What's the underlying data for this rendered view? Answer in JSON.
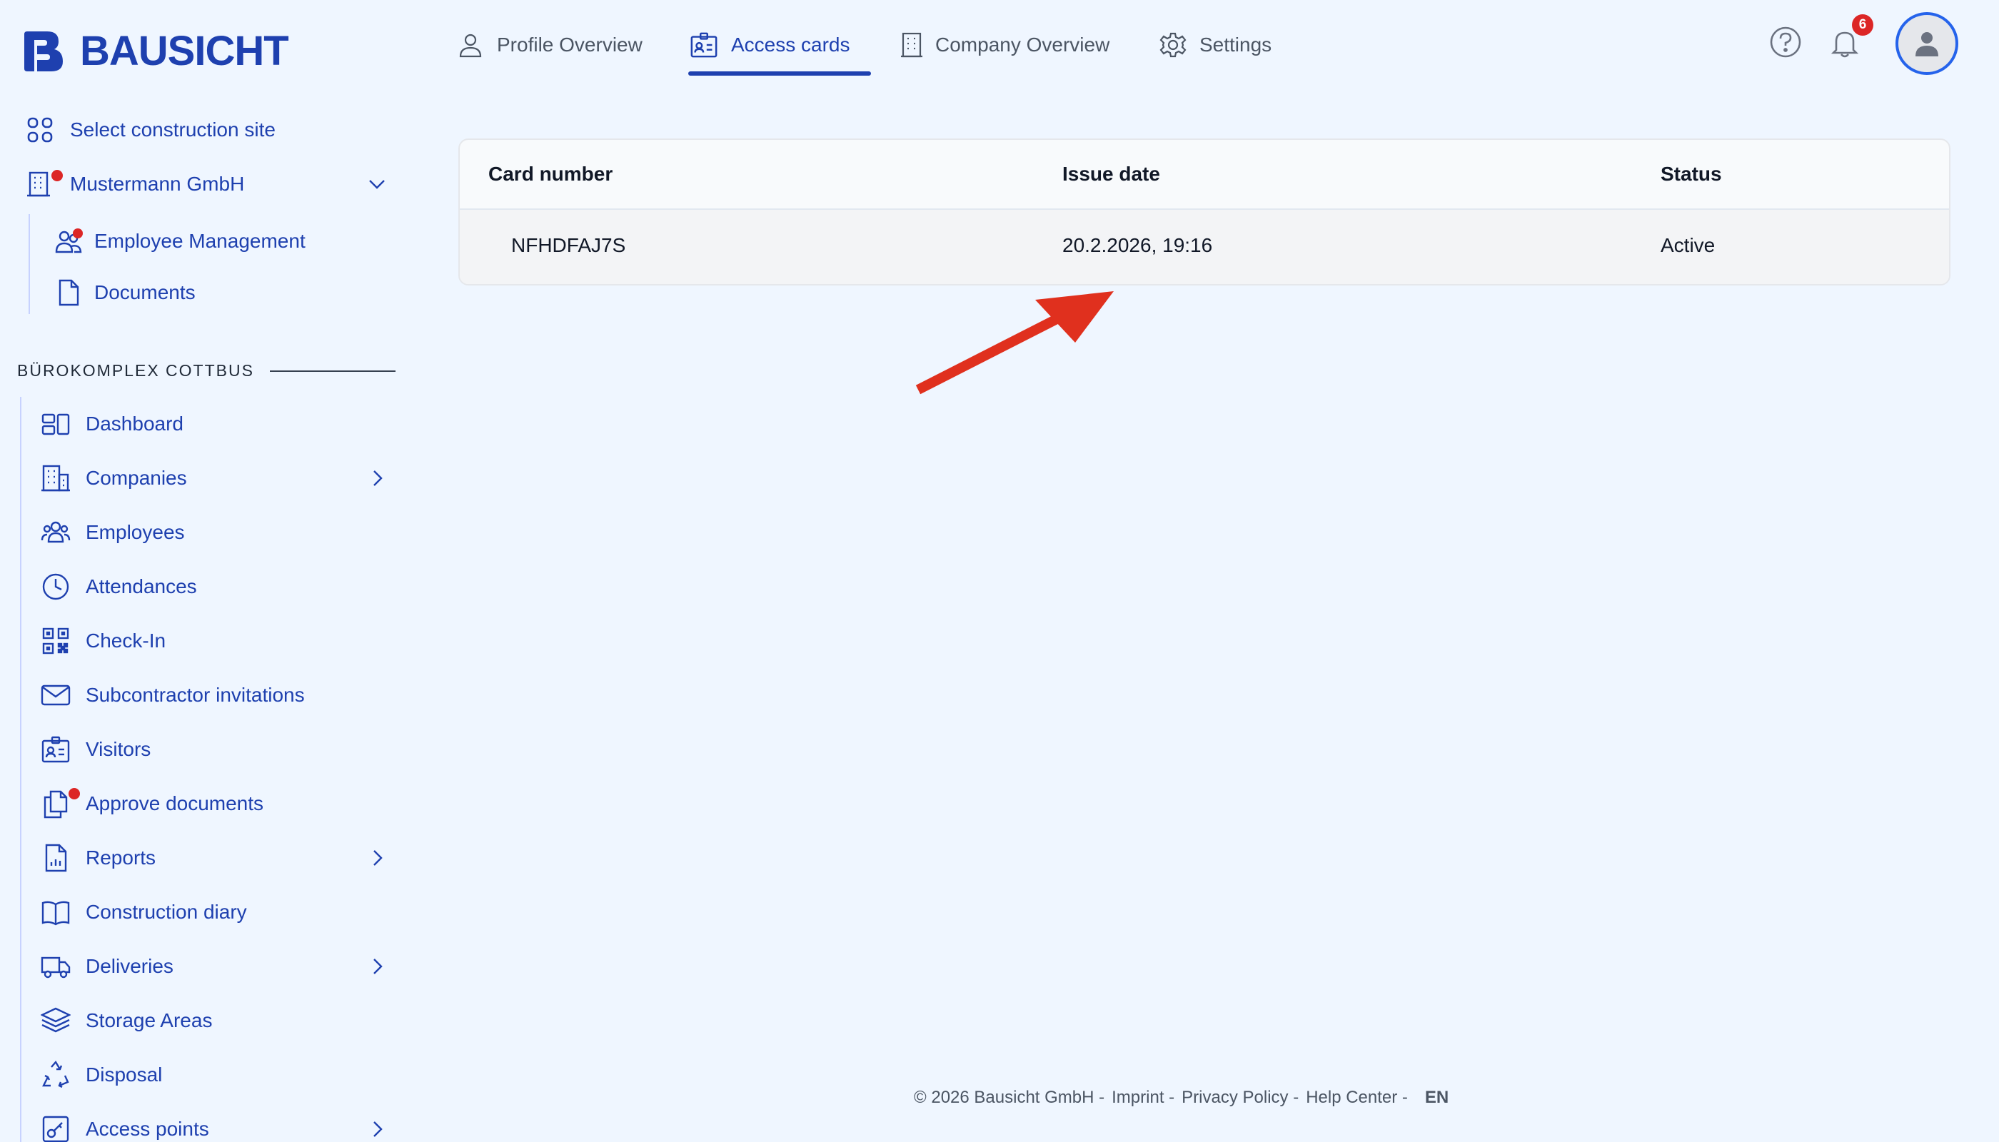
{
  "brand": {
    "name": "BAUSICHT"
  },
  "sidebar": {
    "select_site": "Select construction site",
    "company": "Mustermann GmbH",
    "company_items": [
      {
        "label": "Employee Management",
        "icon": "users-icon"
      },
      {
        "label": "Documents",
        "icon": "document-icon"
      }
    ],
    "section_title": "BÜROKOMPLEX COTTBUS",
    "items": [
      {
        "label": "Dashboard",
        "icon": "dashboard-icon"
      },
      {
        "label": "Companies",
        "icon": "building-icon"
      },
      {
        "label": "Employees",
        "icon": "employees-icon"
      },
      {
        "label": "Attendances",
        "icon": "clock-icon"
      },
      {
        "label": "Check-In",
        "icon": "qr-code-icon"
      },
      {
        "label": "Subcontractor invitations",
        "icon": "mail-icon"
      },
      {
        "label": "Visitors",
        "icon": "id-card-icon"
      },
      {
        "label": "Approve documents",
        "icon": "documents-icon"
      },
      {
        "label": "Reports",
        "icon": "report-icon"
      },
      {
        "label": "Construction diary",
        "icon": "book-icon"
      },
      {
        "label": "Deliveries",
        "icon": "truck-icon"
      },
      {
        "label": "Storage Areas",
        "icon": "layers-icon"
      },
      {
        "label": "Disposal",
        "icon": "recycle-icon"
      },
      {
        "label": "Access points",
        "icon": "door-icon"
      }
    ]
  },
  "topnav": {
    "tabs": [
      {
        "label": "Profile Overview",
        "icon": "user-icon"
      },
      {
        "label": "Access cards",
        "icon": "id-card-icon",
        "active": true
      },
      {
        "label": "Company Overview",
        "icon": "building-icon"
      },
      {
        "label": "Settings",
        "icon": "gear-icon"
      }
    ],
    "notifications_count": "6"
  },
  "table": {
    "headers": [
      "Card number",
      "Issue date",
      "Status"
    ],
    "rows": [
      [
        "NFHDFAJ7S",
        "20.2.2026, 19:16",
        "Active"
      ]
    ]
  },
  "footer": {
    "copyright": "© 2026 Bausicht GmbH -",
    "imprint": "Imprint -",
    "privacy": "Privacy Policy -",
    "help": "Help Center -",
    "language": "EN"
  },
  "colors": {
    "accent": "#1e40af",
    "background": "#eff6ff",
    "alert": "#dc2626",
    "annotation_arrow": "#e0301e"
  }
}
